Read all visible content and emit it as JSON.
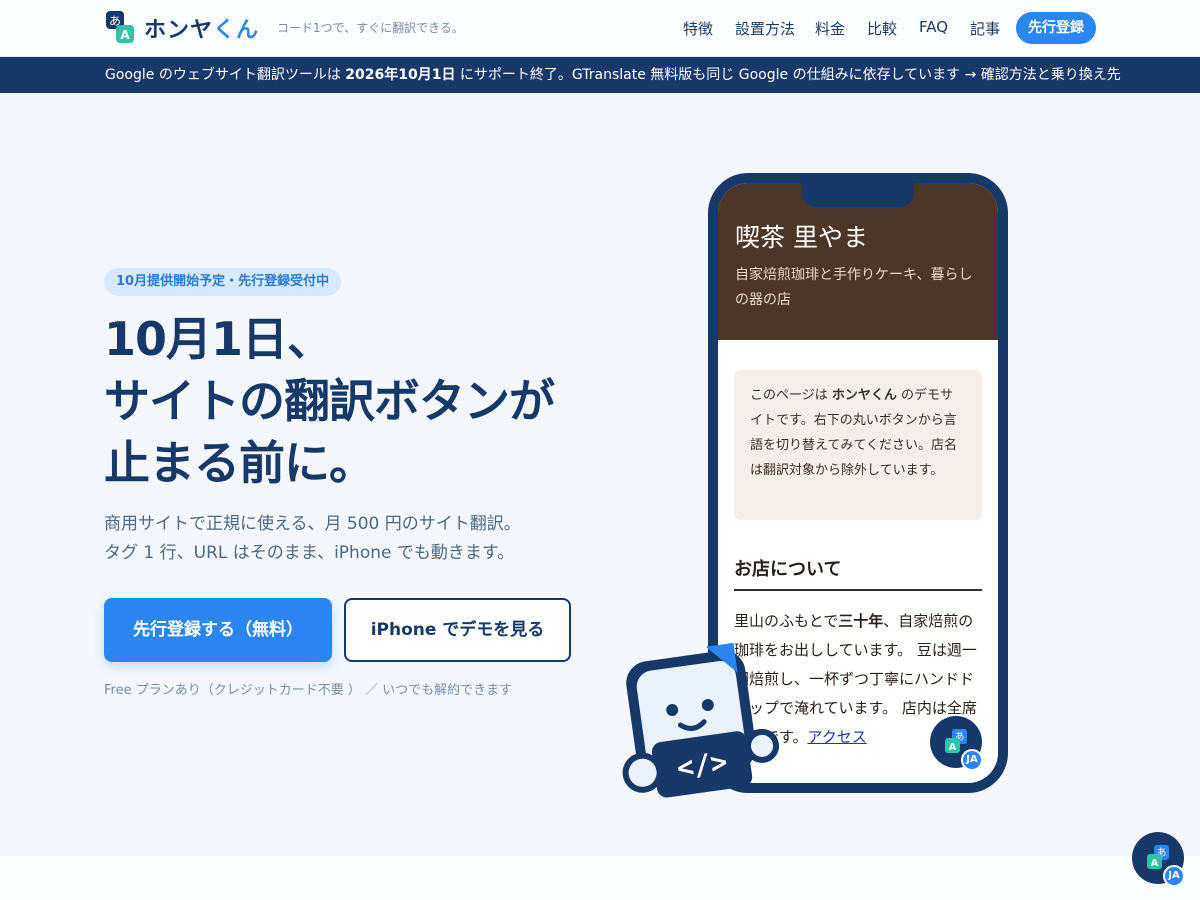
{
  "brand": {
    "name_part1": "ホンヤ",
    "name_part2": "くん",
    "tagline": "コード1つで、すぐに翻訳できる。"
  },
  "nav": {
    "items": [
      "特徴",
      "設置方法",
      "料金",
      "比較",
      "FAQ",
      "記事"
    ],
    "cta": "先行登録"
  },
  "banner": {
    "part1": "Google のウェブサイト翻訳ツールは ",
    "date": "2026年10月1日",
    "part2": " にサポート終了。GTranslate 無料版も同じ Google の仕組みに依存しています → 確認方法と乗り換え先"
  },
  "hero": {
    "badge": "10月提供開始予定・先行登録受付中",
    "headline_line1": "10月1日、",
    "headline_line2": "サイトの翻訳ボタンが",
    "headline_line3": "止まる前に。",
    "sub_line1": "商用サイトで正規に使える、月 500 円のサイト翻訳。",
    "sub_line2": "タグ 1 行、URL はそのまま、iPhone でも動きます。",
    "primary_button": "先行登録する（無料）",
    "secondary_button": "iPhone でデモを見る",
    "fineprint": "Free プランあり（クレジットカード不要 ） ／ いつでも解約できます"
  },
  "demo": {
    "shop_name": "喫茶 里やま",
    "shop_sub": "自家焙煎珈琲と手作りケーキ、暮らしの器の店",
    "notice_part1": "このページは ",
    "notice_brand": "ホンヤくん",
    "notice_part2": " のデモサイトです。右下の丸いボタンから言語を切り替えてみてください。店名は翻訳対象から除外しています。",
    "about_heading": "お店について",
    "body_part1": "里山のふもとで",
    "body_bold": "三十年",
    "body_part2": "、自家焙煎の珈琲をお出ししています。 豆は週一回焙煎し、一杯ずつ丁寧にハンドドリップで淹れています。 店内は全席禁煙です。",
    "body_link": "アクセス",
    "lang_badge": "JA"
  },
  "floating": {
    "lang_badge": "JA"
  },
  "colors": {
    "brand_navy": "#16396a",
    "brand_blue": "#2a86f2",
    "cafe_brown": "#4b3627"
  }
}
